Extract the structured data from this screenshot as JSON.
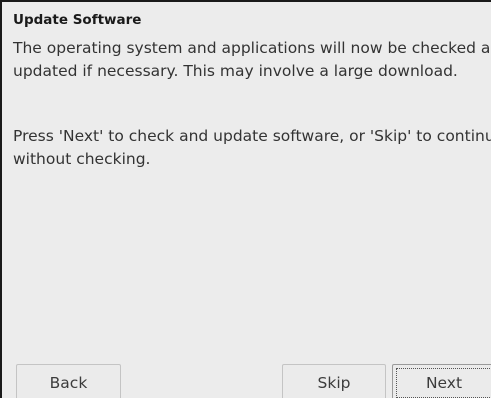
{
  "dialog": {
    "title": "Update Software",
    "paragraph1": {
      "line1": "The operating system and applications will now be checked and",
      "line2": "updated if necessary. This may involve a large download."
    },
    "paragraph2": {
      "line1": "Press 'Next' to check and update software, or 'Skip' to continue",
      "line2": "without checking."
    }
  },
  "buttons": {
    "back_label": "Back",
    "skip_label": "Skip",
    "next_label": "Next"
  }
}
